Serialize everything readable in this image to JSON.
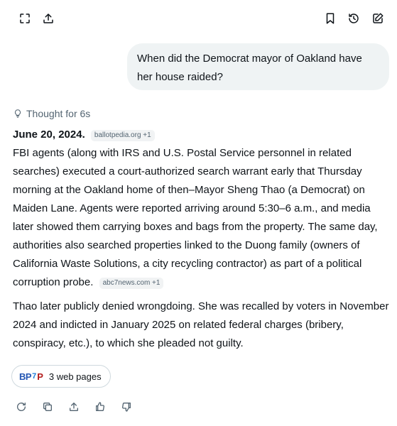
{
  "user_message": "When did the Democrat mayor of Oakland have her house raided?",
  "thought_label": "Thought for 6s",
  "answer": {
    "date": "June 20, 2024.",
    "cite1": "ballotpedia.org +1",
    "p1_text": "FBI agents (along with IRS and U.S. Postal Service personnel in related searches) executed a court-authorized search warrant early that Thursday morning at the Oakland home of then–Mayor Sheng Thao (a Democrat) on Maiden Lane. Agents were reported arriving around 5:30–6 a.m., and media later showed them carrying boxes and bags from the property. The same day, authorities also searched properties linked to the Duong family (owners of California Waste Solutions, a city recycling contractor) as part of a political corruption probe.",
    "cite2": "abc7news.com +1",
    "p2_text": "Thao later publicly denied wrongdoing. She was recalled by voters in November 2024 and indicted in January 2025 on related federal charges (bribery, conspiracy, etc.), to which she pleaded not guilty."
  },
  "sources": {
    "logo_bp": "BP",
    "logo_7": "7",
    "logo_p": "P",
    "label": "3 web pages"
  },
  "icons": {
    "top_left": [
      "expand-icon",
      "share-icon"
    ],
    "top_right": [
      "bookmark-icon",
      "history-icon",
      "edit-icon"
    ],
    "actions": [
      "regenerate-icon",
      "copy-icon",
      "share-icon",
      "thumbs-up-icon",
      "thumbs-down-icon"
    ]
  }
}
